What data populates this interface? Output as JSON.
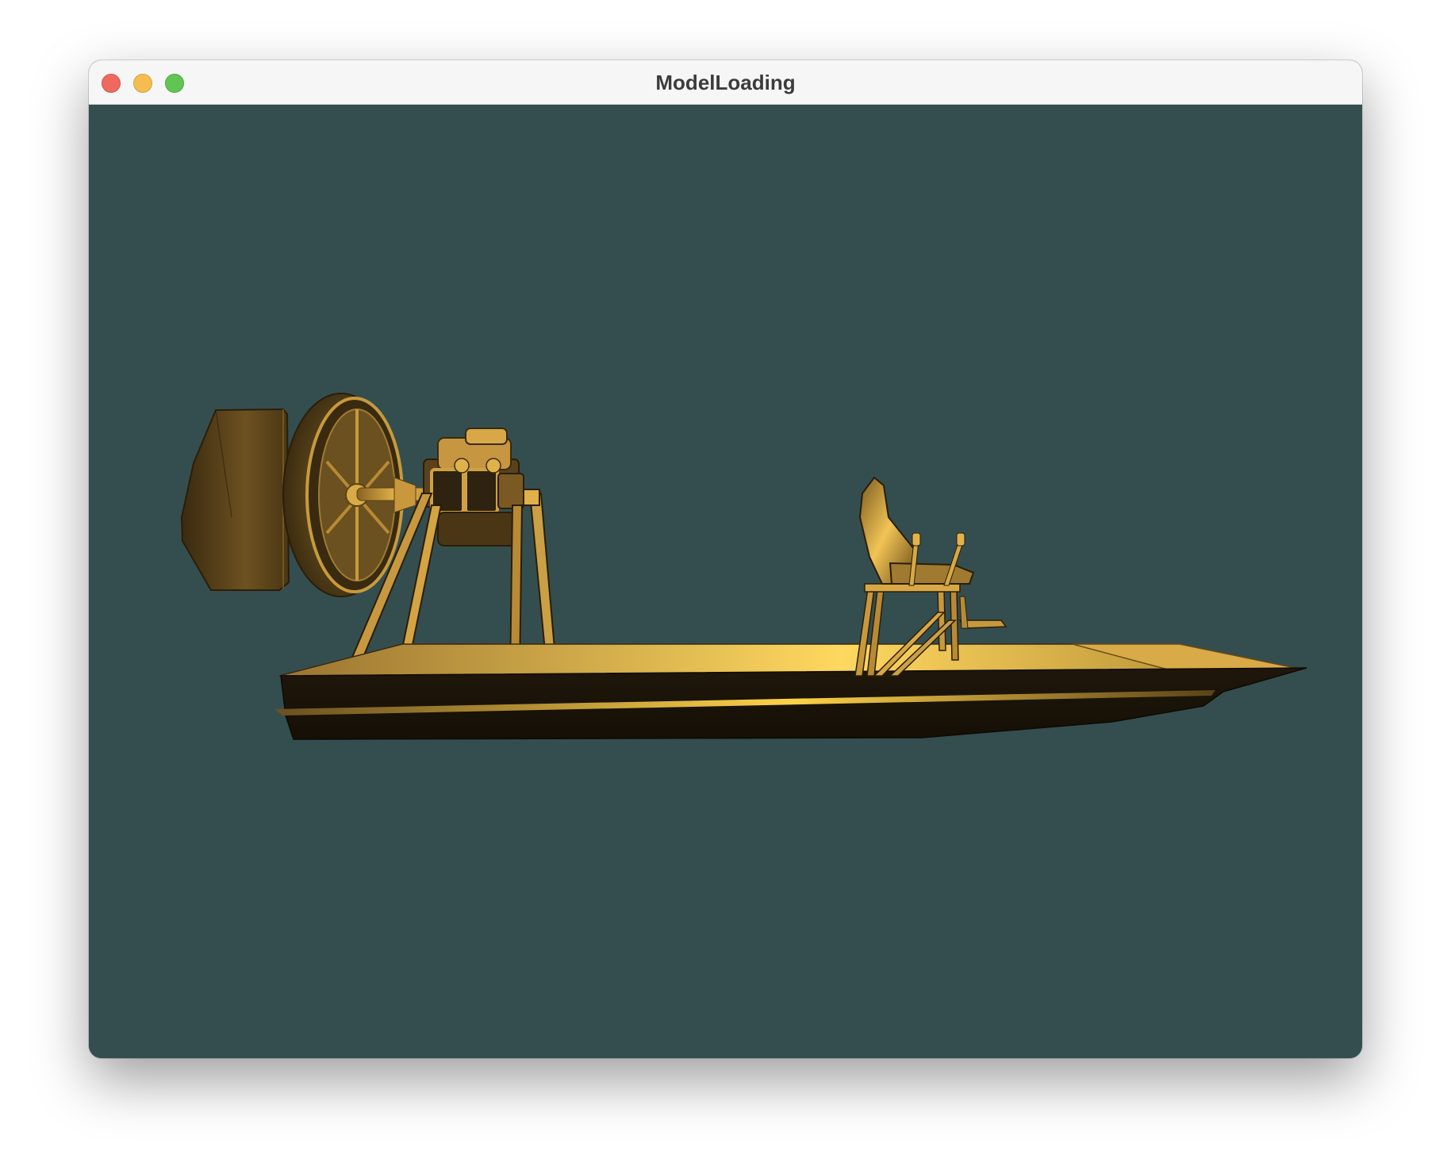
{
  "window": {
    "title": "ModelLoading"
  },
  "controls": {
    "close": "close-button",
    "minimize": "minimize-button",
    "maximize": "zoom-button"
  },
  "scene": {
    "background_color": "#344e4f",
    "model_color": "#e8a83a",
    "model": "airboat"
  }
}
